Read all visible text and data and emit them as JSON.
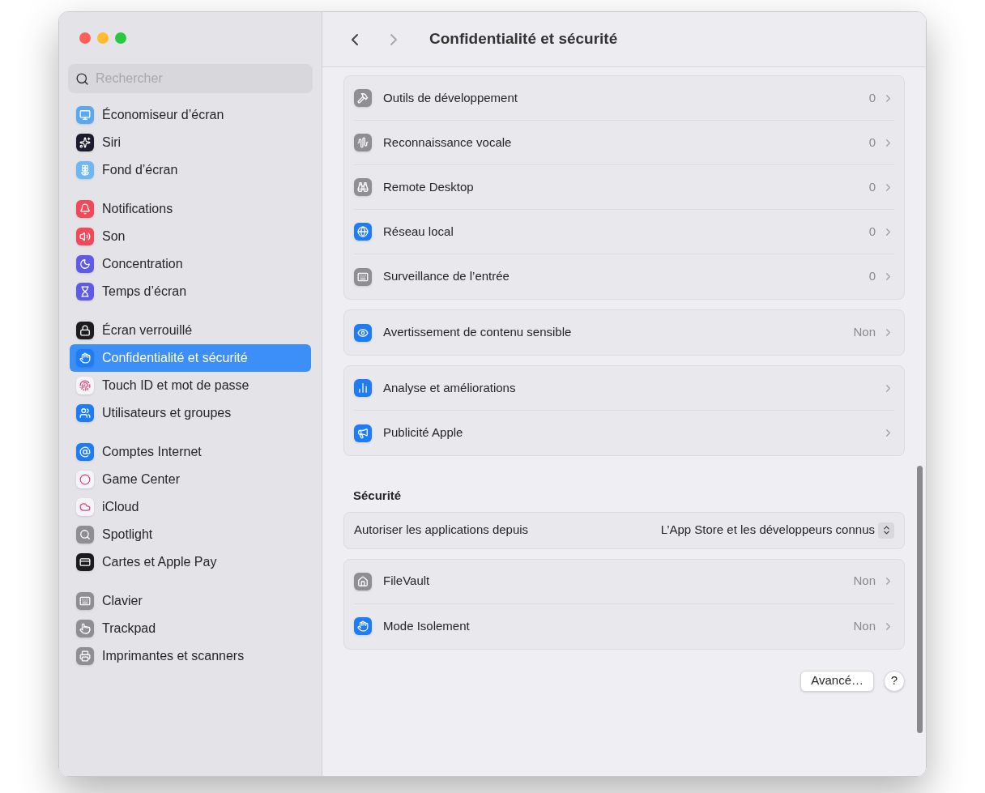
{
  "sidebar": {
    "search": {
      "placeholder": "Rechercher"
    },
    "groups": [
      {
        "items": [
          {
            "label": "Économiseur d’écran",
            "selected": false
          },
          {
            "label": "Siri",
            "selected": false
          },
          {
            "label": "Fond d’écran",
            "selected": false
          }
        ]
      },
      {
        "items": [
          {
            "label": "Notifications",
            "selected": false
          },
          {
            "label": "Son",
            "selected": false
          },
          {
            "label": "Concentration",
            "selected": false
          },
          {
            "label": "Temps d’écran",
            "selected": false
          }
        ]
      },
      {
        "items": [
          {
            "label": "Écran verrouillé",
            "selected": false
          },
          {
            "label": "Confidentialité et sécurité",
            "selected": true
          },
          {
            "label": "Touch ID et mot de passe",
            "selected": false
          },
          {
            "label": "Utilisateurs et groupes",
            "selected": false
          }
        ]
      },
      {
        "items": [
          {
            "label": "Comptes Internet",
            "selected": false
          },
          {
            "label": "Game Center",
            "selected": false
          },
          {
            "label": "iCloud",
            "selected": false
          },
          {
            "label": "Spotlight",
            "selected": false
          },
          {
            "label": "Cartes et Apple Pay",
            "selected": false
          }
        ]
      },
      {
        "items": [
          {
            "label": "Clavier",
            "selected": false
          },
          {
            "label": "Trackpad",
            "selected": false
          },
          {
            "label": "Imprimantes et scanners",
            "selected": false
          }
        ]
      }
    ]
  },
  "toolbar": {
    "title": "Confidentialité et sécurité"
  },
  "sections": [
    {
      "groups": [
        {
          "rows": [
            {
              "kind": "link",
              "label": "Outils de développement",
              "value": "0"
            },
            {
              "kind": "link",
              "label": "Reconnaissance vocale",
              "value": "0"
            },
            {
              "kind": "link",
              "label": "Remote Desktop",
              "value": "0"
            },
            {
              "kind": "link",
              "label": "Réseau local",
              "value": "0"
            },
            {
              "kind": "link",
              "label": "Surveillance de l’entrée",
              "value": "0"
            }
          ]
        },
        {
          "rows": [
            {
              "kind": "link",
              "label": "Avertissement de contenu sensible",
              "value": "Non"
            }
          ]
        },
        {
          "rows": [
            {
              "kind": "link",
              "label": "Analyse et améliorations"
            },
            {
              "kind": "link",
              "label": "Publicité Apple"
            }
          ]
        }
      ]
    },
    {
      "title": "Sécurité",
      "groups": [
        {
          "rows": [
            {
              "kind": "popup",
              "label": "Autoriser les applications depuis",
              "value": "L’App Store et les développeurs connus"
            }
          ]
        },
        {
          "rows": [
            {
              "kind": "link",
              "label": "FileVault",
              "value": "Non"
            },
            {
              "kind": "link",
              "label": "Mode Isolement",
              "value": "Non"
            }
          ]
        }
      ]
    }
  ],
  "footer": {
    "buttons": [
      "Avancé…",
      "?"
    ]
  }
}
